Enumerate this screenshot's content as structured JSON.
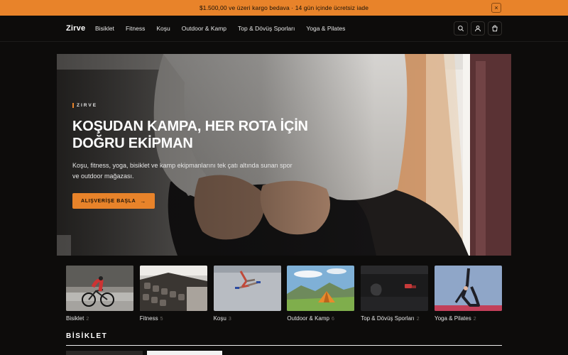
{
  "announcement": {
    "text": "$1.500,00 ve üzeri kargo bedava · 14 gün içinde ücretsiz iade",
    "close_label": "×"
  },
  "header": {
    "logo": "Zirve",
    "nav": [
      "Bisiklet",
      "Fitness",
      "Koşu",
      "Outdoor & Kamp",
      "Top & Dövüş Sporları",
      "Yoga & Pilates"
    ],
    "icons": [
      "search-icon",
      "account-icon",
      "cart-icon"
    ]
  },
  "hero": {
    "eyebrow": "ZIRVE",
    "title": "KOŞUDAN KAMPA, HER ROTA İÇİN DOĞRU EKİPMAN",
    "description": "Koşu, fitness, yoga, bisiklet ve kamp ekipmanlarını tek çatı altında sunan spor ve outdoor mağazası.",
    "cta_label": "ALIŞVERİŞE BAŞLA",
    "cta_arrow": "→"
  },
  "categories": [
    {
      "label": "Bisiklet",
      "count": "2"
    },
    {
      "label": "Fitness",
      "count": "5"
    },
    {
      "label": "Koşu",
      "count": "3"
    },
    {
      "label": "Outdoor & Kamp",
      "count": "6"
    },
    {
      "label": "Top & Dövüş Sporları",
      "count": "2"
    },
    {
      "label": "Yoga & Pilates",
      "count": "2"
    }
  ],
  "section": {
    "title": "BİSİKLET"
  },
  "colors": {
    "accent": "#e8832a",
    "background": "#0d0c0b"
  }
}
